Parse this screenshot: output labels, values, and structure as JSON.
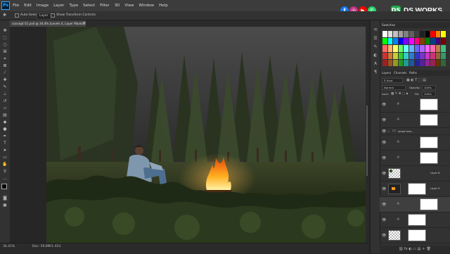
{
  "menubar": {
    "app_icon": "Ps",
    "items": [
      "File",
      "Edit",
      "Image",
      "Layer",
      "Type",
      "Select",
      "Filter",
      "3D",
      "View",
      "Window",
      "Help"
    ],
    "social_icons": [
      "facebook-icon",
      "instagram-icon",
      "youtube-icon",
      "whatsapp-icon"
    ],
    "brand_text": "DS WORKS",
    "brand_logo": "DS"
  },
  "options_bar": {
    "auto_select_label": "Auto-Select:",
    "auto_select_value": "Layer",
    "transform_label": "Show Transform Controls"
  },
  "document_tab": {
    "title": "concept 01.psd @ 34.4% (Levels 4, Layer Mask/8) *",
    "close": "×"
  },
  "status_bar": {
    "zoom": "34.41%",
    "doc_info": "Doc: 59.8M/1.41G"
  },
  "panels": {
    "swatches_tab": "Swatches",
    "layers_tabs": [
      "Layers",
      "Channels",
      "Paths"
    ],
    "kind_label": "Kind",
    "blend_mode": "Normal",
    "opacity_label": "Opacity:",
    "opacity_value": "100%",
    "lock_label": "Lock:",
    "fill_label": "Fill:",
    "fill_value": "100%",
    "group_name": "small tree...",
    "layer_names": [
      "Layer 8",
      "Layer 9"
    ]
  },
  "swatch_colors": [
    "#ffffff",
    "#e0e0e0",
    "#c0c0c0",
    "#a0a0a0",
    "#808080",
    "#606060",
    "#404040",
    "#202020",
    "#000000",
    "#ff0000",
    "#ff8000",
    "#ffff00",
    "#00ff00",
    "#00ffff",
    "#0080ff",
    "#0000ff",
    "#8000ff",
    "#ff00ff",
    "#ff0080",
    "#804000",
    "#008000",
    "#004080",
    "#400080",
    "#800000",
    "#ff6666",
    "#ffb366",
    "#ffff66",
    "#66ff66",
    "#66ffff",
    "#66b3ff",
    "#6666ff",
    "#b366ff",
    "#ff66ff",
    "#ff66b3",
    "#c08040",
    "#40c080",
    "#cc3333",
    "#cc7a33",
    "#cccc33",
    "#33cc33",
    "#33cccc",
    "#337acc",
    "#3333cc",
    "#7a33cc",
    "#cc33cc",
    "#cc337a",
    "#996633",
    "#339966",
    "#992222",
    "#995522",
    "#999922",
    "#229922",
    "#229999",
    "#225599",
    "#222299",
    "#552299",
    "#992299",
    "#992255",
    "#663300",
    "#336633"
  ],
  "accent_colors": {
    "brand_green": "#1fa84a",
    "facebook": "#1877f2",
    "instagram": "#c13584",
    "youtube": "#ff0000",
    "whatsapp": "#25d366"
  }
}
